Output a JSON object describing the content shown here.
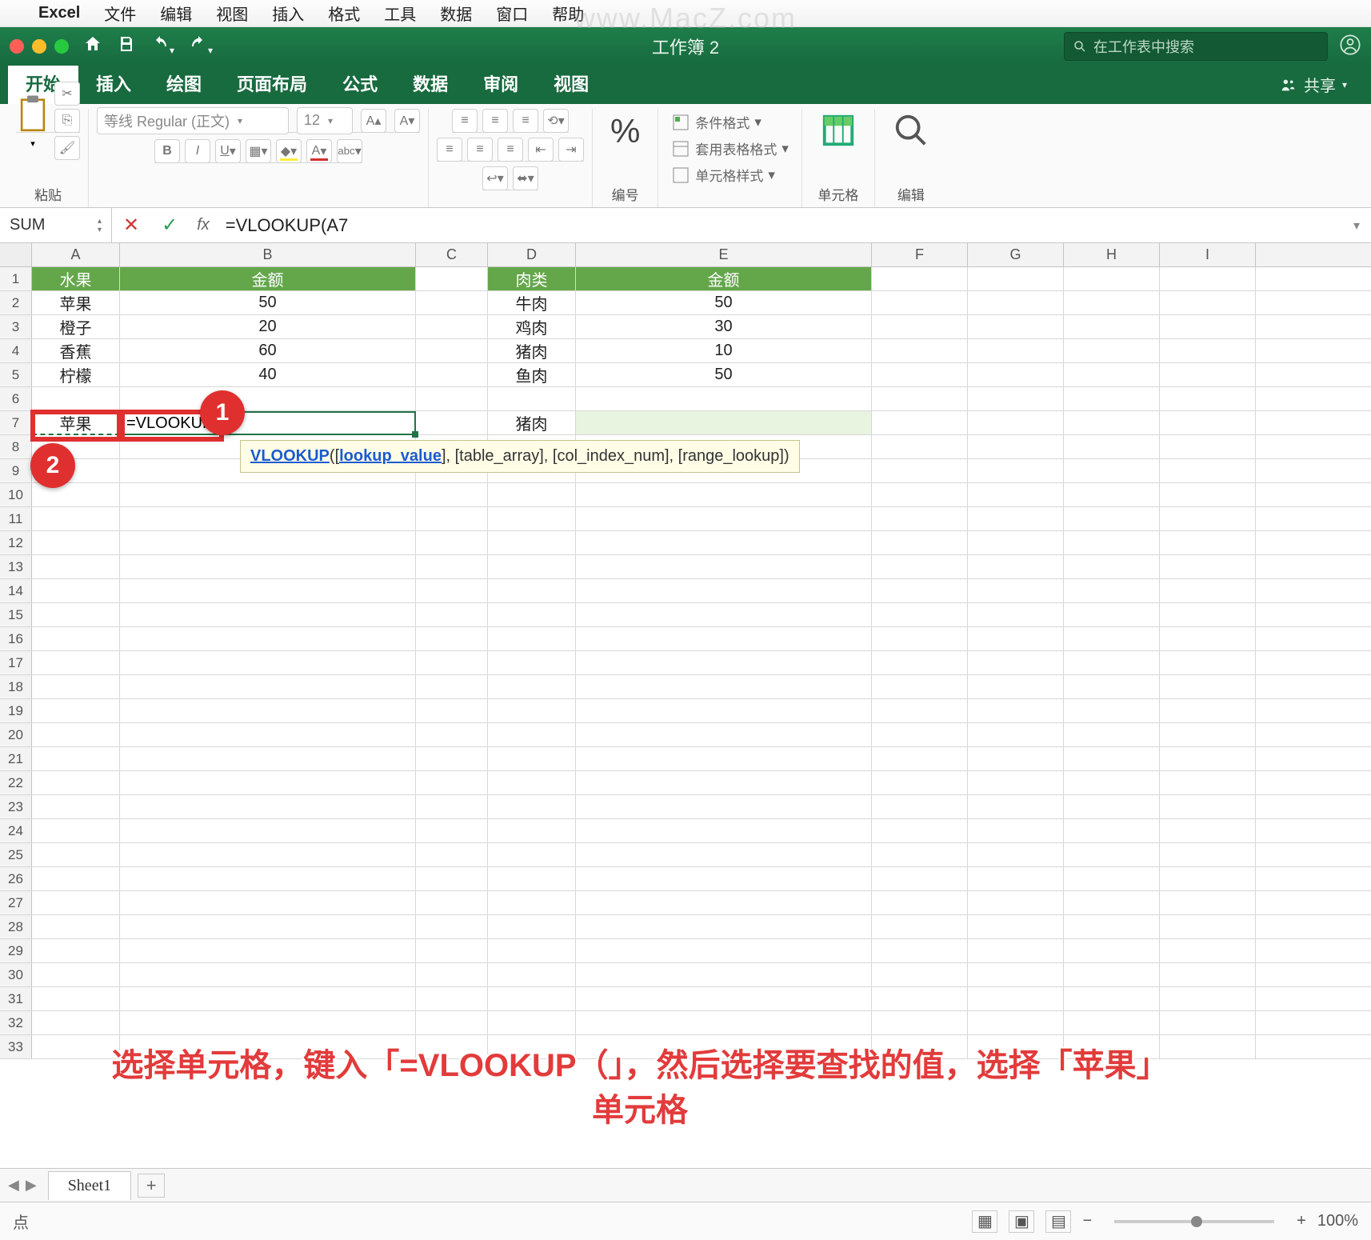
{
  "mac_menu": {
    "app": "Excel",
    "items": [
      "文件",
      "编辑",
      "视图",
      "插入",
      "格式",
      "工具",
      "数据",
      "窗口",
      "帮助"
    ]
  },
  "watermark": "www.MacZ.com",
  "titlebar": {
    "title": "工作簿 2",
    "search_placeholder": "在工作表中搜索"
  },
  "ribbon_tabs": [
    "开始",
    "插入",
    "绘图",
    "页面布局",
    "公式",
    "数据",
    "审阅",
    "视图"
  ],
  "share_label": "共享",
  "ribbon": {
    "paste_label": "粘贴",
    "font_name": "等线 Regular (正文)",
    "font_size": "12",
    "number_label": "编号",
    "cond_fmt": "条件格式",
    "table_fmt": "套用表格格式",
    "cell_style": "单元格样式",
    "cells_label": "单元格",
    "edit_label": "编辑"
  },
  "formula_bar": {
    "name": "SUM",
    "formula": "=VLOOKUP(A7"
  },
  "columns": [
    "A",
    "B",
    "C",
    "D",
    "E",
    "F",
    "G",
    "H",
    "I"
  ],
  "table1": {
    "headers": [
      "水果",
      "金额"
    ],
    "rows": [
      [
        "苹果",
        "50"
      ],
      [
        "橙子",
        "20"
      ],
      [
        "香蕉",
        "60"
      ],
      [
        "柠檬",
        "40"
      ]
    ]
  },
  "table2": {
    "headers": [
      "肉类",
      "金额"
    ],
    "rows": [
      [
        "牛肉",
        "50"
      ],
      [
        "鸡肉",
        "30"
      ],
      [
        "猪肉",
        "10"
      ],
      [
        "鱼肉",
        "50"
      ]
    ]
  },
  "a7": "苹果",
  "b7_editing": "=VLOOKUP(A7",
  "d7": "猪肉",
  "tooltip": {
    "fn": "VLOOKUP",
    "arg1": "lookup_value",
    "rest": ", [table_array], [col_index_num], [range_lookup])"
  },
  "callouts": {
    "one": "1",
    "two": "2"
  },
  "annotation_line1": "选择单元格，键入「=VLOOKUP（」，然后选择要查找的值，选择「苹果」",
  "annotation_line2": "单元格",
  "sheet_tab": "Sheet1",
  "status": {
    "mode": "点",
    "zoom": "100%"
  }
}
